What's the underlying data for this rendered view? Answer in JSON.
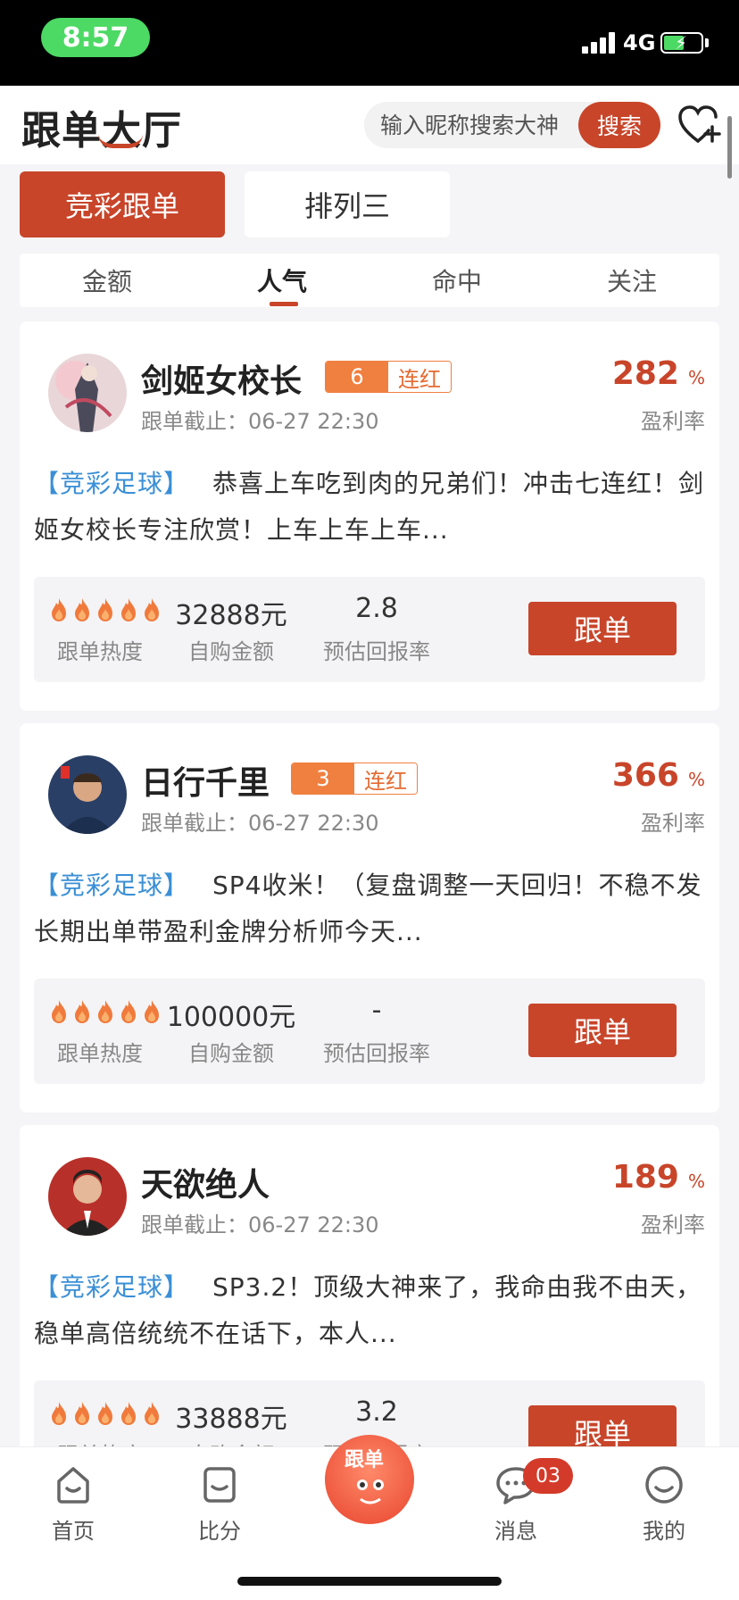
{
  "status_bar": {
    "time": "8:57",
    "network": "4G"
  },
  "header": {
    "title": "跟单大厅",
    "search_placeholder": "输入昵称搜索大神",
    "search_button": "搜索"
  },
  "category_tabs": [
    {
      "label": "竞彩跟单",
      "active": true
    },
    {
      "label": "排列三",
      "active": false
    }
  ],
  "sort_tabs": [
    {
      "label": "金额",
      "active": false
    },
    {
      "label": "人气",
      "active": true
    },
    {
      "label": "命中",
      "active": false
    },
    {
      "label": "关注",
      "active": false
    }
  ],
  "cards": [
    {
      "name": "剑姬女校长",
      "streak": "6",
      "streak_label": "连红",
      "deadline": "跟单截止：06-27 22:30",
      "profit_rate": "282",
      "profit_unit": "%",
      "profit_label": "盈利率",
      "tag": "【竞彩足球】",
      "description": "恭喜上车吃到肉的兄弟们！冲击七连红！剑姬女校长专注欣赏！上车上车上车...",
      "heat_level": 5,
      "heat_label": "跟单热度",
      "amount": "32888元",
      "amount_label": "自购金额",
      "return_rate": "2.8",
      "return_label": "预估回报率",
      "follow_button": "跟单"
    },
    {
      "name": "日行千里",
      "streak": "3",
      "streak_label": "连红",
      "deadline": "跟单截止：06-27 22:30",
      "profit_rate": "366",
      "profit_unit": "%",
      "profit_label": "盈利率",
      "tag": "【竞彩足球】",
      "description": "SP4收米！（复盘调整一天回归！不稳不发长期出单带盈利金牌分析师今天...",
      "heat_level": 5,
      "heat_label": "跟单热度",
      "amount": "100000元",
      "amount_label": "自购金额",
      "return_rate": "-",
      "return_label": "预估回报率",
      "follow_button": "跟单"
    },
    {
      "name": "天欲绝人",
      "streak": "",
      "streak_label": "",
      "deadline": "跟单截止：06-27 22:30",
      "profit_rate": "189",
      "profit_unit": "%",
      "profit_label": "盈利率",
      "tag": "【竞彩足球】",
      "description": "SP3.2！顶级大神来了，我命由我不由天，稳单高倍统统不在话下，本人...",
      "heat_level": 5,
      "heat_label": "跟单热度",
      "amount": "33888元",
      "amount_label": "自购金额",
      "return_rate": "3.2",
      "return_label": "预估回报率",
      "follow_button": "跟单"
    }
  ],
  "bottom_nav": [
    {
      "label": "首页",
      "icon": "home-icon"
    },
    {
      "label": "比分",
      "icon": "score-icon"
    },
    {
      "label": "跟单",
      "icon": "follow-center-icon"
    },
    {
      "label": "消息",
      "icon": "message-icon",
      "badge": "03"
    },
    {
      "label": "我的",
      "icon": "profile-icon"
    }
  ],
  "colors": {
    "accent": "#c8452a",
    "tag_blue": "#3a8fd6",
    "streak_orange": "#f08040"
  }
}
